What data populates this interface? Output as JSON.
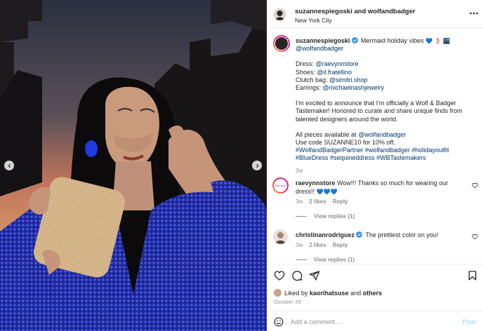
{
  "header": {
    "user1": "suzannespiegoski",
    "connector": " and ",
    "user2": "wolfandbadger",
    "location": "New York City"
  },
  "caption": {
    "username": "suzannespiegoski",
    "title_text": "Mermaid holiday vibes",
    "title_emoji": "💙 🧜‍♀️ 🌃",
    "mention_brand": "@wolfandbadger",
    "credits": [
      {
        "label": "Dress: ",
        "handle": "@raevynnstore"
      },
      {
        "label": "Shoes: ",
        "handle": "@il.fratellino"
      },
      {
        "label": "Clutch bag: ",
        "handle": "@simitri.shop"
      },
      {
        "label": "Earrings: ",
        "handle": "@michaelnashjewelry"
      }
    ],
    "announcement": "I'm excited to announce that I'm officially a Wolf & Badger Tastemaker! Honored to curate and share unique finds from talented designers around the world.",
    "available_prefix": "All pieces available at ",
    "available_handle": "@wolfandbadger",
    "code_line": "Use code SUZANNE10 for 10% off.",
    "hashtags_line1": "#WolfandBadgerPartner #wolfandbadger #holidayoutfit",
    "hashtags_line2": "#BlueDress #sequineddress #WBTastemakers",
    "time": "3w"
  },
  "comments": [
    {
      "username": "raevynnstore",
      "text": "Wow!!! Thanks so much for wearing our dress!!",
      "emoji": "💙💙💙",
      "time": "3w",
      "likes": "2 likes",
      "reply": "Reply",
      "view_replies": "View replies (1)",
      "avatar_text": "RaVynn"
    },
    {
      "username": "christinanrodriguez",
      "text": "The prettiest color on you!",
      "time": "3w",
      "likes": "2 likes",
      "reply": "Reply",
      "view_replies": "View replies (1)"
    }
  ],
  "likes": {
    "prefix": "Liked by ",
    "user": "kaorihatsuse",
    "and": " and ",
    "others": "others"
  },
  "date": "October 26",
  "composer": {
    "placeholder": "Add a comment…",
    "post_label": "Post"
  },
  "colors": {
    "link": "#00376b",
    "verified": "#3897f0",
    "post_disabled": "#b8d9f7",
    "secondary_text": "#8e8e8e"
  },
  "icons": {
    "like": "heart-icon",
    "comment": "comment-icon",
    "share": "paper-plane-icon",
    "save": "bookmark-icon",
    "more": "more-horizontal-icon",
    "emoji": "smiley-icon"
  }
}
